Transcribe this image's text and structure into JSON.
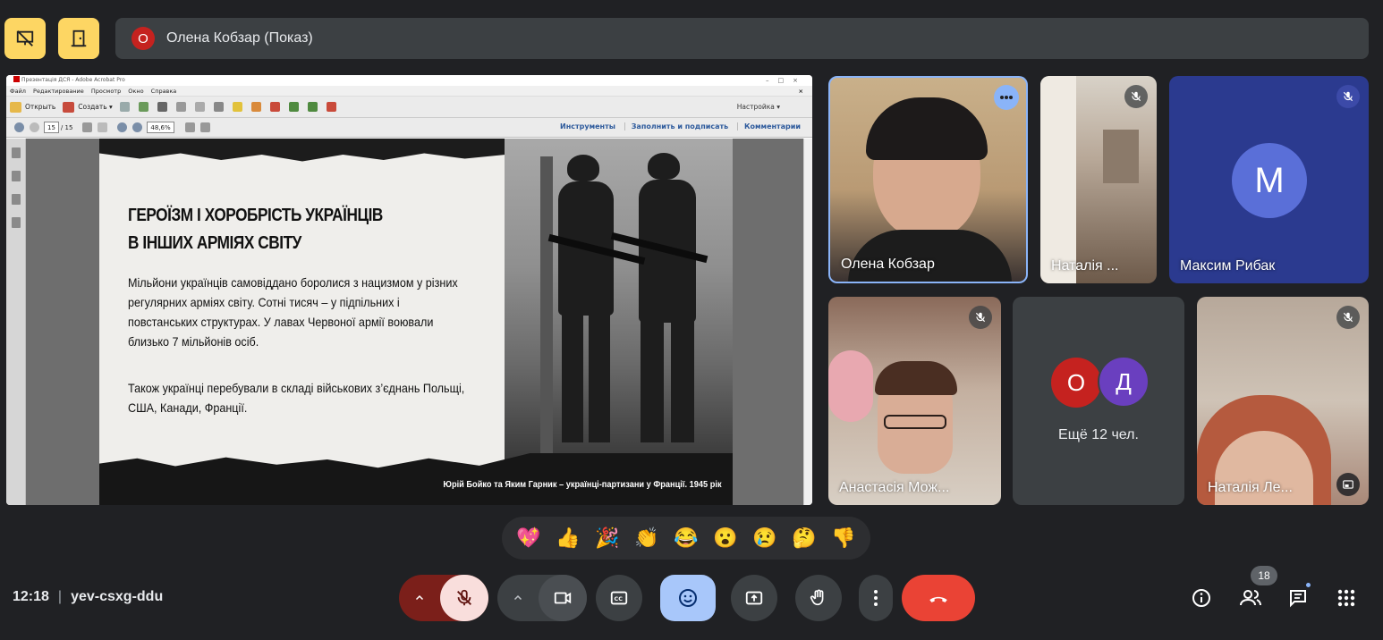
{
  "top_bar": {
    "presenter_initial": "О",
    "presenter_label": "Олена Кобзар (Показ)"
  },
  "shared_screen": {
    "window_title": "Презентація ДСЯ - Adobe Acrobat Pro",
    "menu": [
      "Файл",
      "Редактирование",
      "Просмотр",
      "Окно",
      "Справка"
    ],
    "toolbar": {
      "open": "Открыть",
      "create": "Создать ▾",
      "customize": "Настройка ▾"
    },
    "nav": {
      "page_current": "15",
      "page_total": "/ 15",
      "zoom": "48,6%"
    },
    "links": [
      "Инструменты",
      "Заполнить и подписать",
      "Комментарии"
    ],
    "slide": {
      "heading_line1": "ГЕРОЇЗМ І ХОРОБРІСТЬ УКРАЇНЦІВ",
      "heading_line2": "В ІНШИХ АРМІЯХ СВІТУ",
      "paragraph1": "Мільйони українців самовіддано боролися з нацизмом у різних регулярних арміях світу. Сотні тисяч – у підпільних і повстанських структурах. У лавах Червоної армії воювали близько 7 мільйонів осіб.",
      "paragraph2": "Також українці перебували в складі військових з’єднань Польщі, США, Канади, Франції.",
      "photo_caption": "Юрій Бойко та Яким Гарник – українці-партизани у Франції. 1945 рік"
    }
  },
  "participants": [
    {
      "name": "Олена Кобзар",
      "muted": false,
      "video": true
    },
    {
      "name": "Наталія ...",
      "muted": true,
      "video": true
    },
    {
      "name": "Максим Рибак",
      "initial": "М",
      "muted": true,
      "video": false,
      "avatar_color": "#5a6fd8"
    },
    {
      "name": "Анастасія Мож...",
      "muted": true,
      "video": true
    },
    {
      "others_label": "Ещё 12 чел.",
      "initials": [
        "О",
        "Д"
      ],
      "colors": [
        "#c5221f",
        "#6a3fbf"
      ]
    },
    {
      "name": "Наталія Ле...",
      "muted": true,
      "video": true
    }
  ],
  "reactions": [
    "💖",
    "👍",
    "🎉",
    "👏",
    "😂",
    "😮",
    "😢",
    "🤔",
    "👎"
  ],
  "bottom_bar": {
    "time": "12:18",
    "meeting_code": "yev-csxg-ddu",
    "people_count": "18"
  },
  "colors": {
    "background": "#202124",
    "surface": "#3c4043",
    "accent_yellow": "#fdd663",
    "hangup_red": "#ea4335",
    "mic_off_bg": "#f9dedc",
    "reaction_active": "#a8c7fa"
  }
}
